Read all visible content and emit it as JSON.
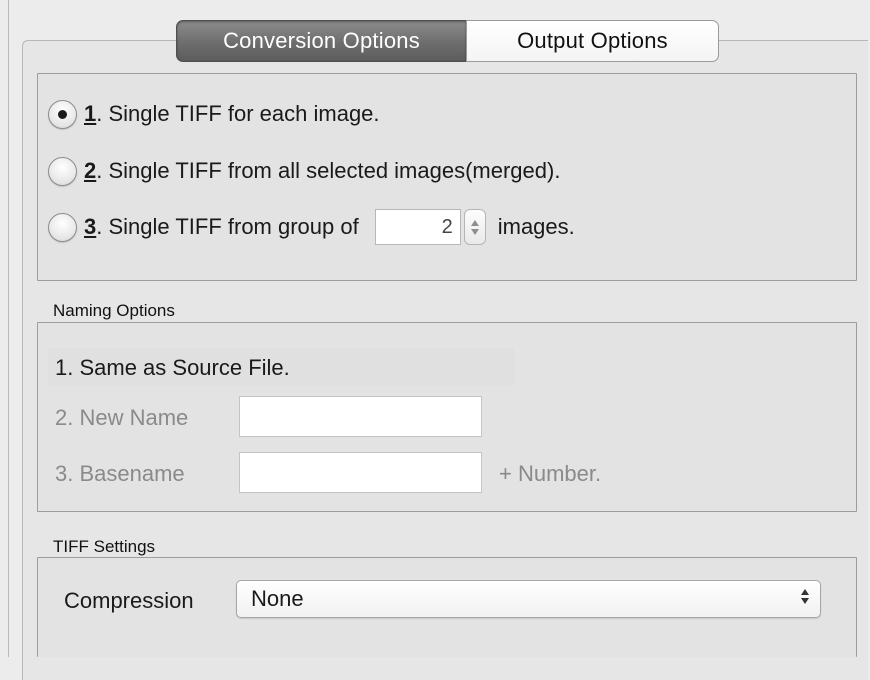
{
  "tabs": {
    "conversion_label": "Conversion Options",
    "output_label": "Output Options"
  },
  "conversion": {
    "options": [
      {
        "number": "1",
        "rest": ". Single TIFF for each image.",
        "selected": true
      },
      {
        "number": "2",
        "rest": ". Single TIFF from all selected images(merged).",
        "selected": false
      },
      {
        "number": "3",
        "rest": ". Single TIFF from group of",
        "selected": false
      }
    ],
    "group_value": "2",
    "group_suffix": "images."
  },
  "naming": {
    "title": "Naming Options",
    "same_as_source": "1. Same as Source File.",
    "new_name_label": "2. New Name",
    "new_name_value": "",
    "basename_label": "3. Basename",
    "basename_value": "",
    "number_suffix": "+ Number."
  },
  "tiff": {
    "title": "TIFF Settings",
    "compression_label": "Compression",
    "compression_value": "None"
  }
}
